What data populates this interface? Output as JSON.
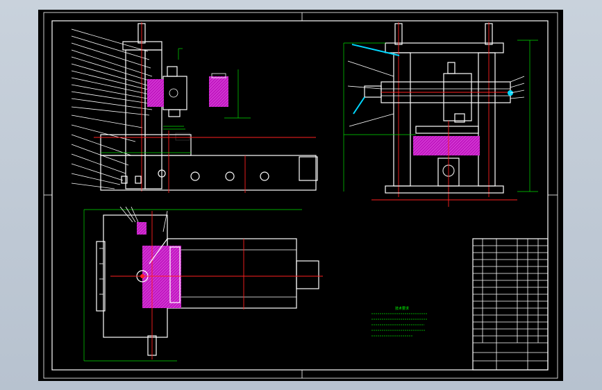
{
  "title_block": {
    "drawing_title": "",
    "scale_text": ""
  },
  "tech_notes": {
    "heading": "技术要求",
    "lines": [
      "",
      "",
      "",
      "",
      ""
    ]
  },
  "colors": {
    "background": "#000000",
    "outline": "#ffffff",
    "dimension": "#00e000",
    "centerline": "#ff2020",
    "section_fill": "#d020d0",
    "cable": "#00d8ff",
    "viewport_frame": "#b7c2cf"
  }
}
